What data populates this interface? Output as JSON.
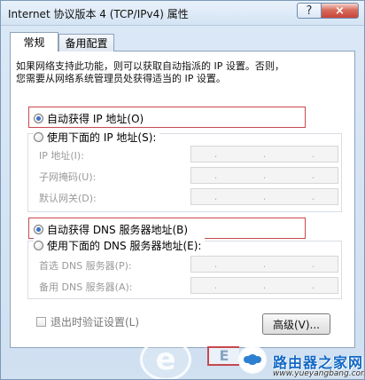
{
  "window": {
    "title": "Internet 协议版本 4 (TCP/IPv4) 属性",
    "help_button": "?",
    "close_button": "×"
  },
  "tabs": [
    {
      "label": "常规",
      "active": true
    },
    {
      "label": "备用配置",
      "active": false
    }
  ],
  "description": {
    "line1": "如果网络支持此功能，则可以获取自动指派的 IP 设置。否则，",
    "line2": "您需要从网络系统管理员处获得适当的 IP 设置。"
  },
  "ip_settings": {
    "auto_option": "自动获得 IP 地址(O)",
    "manual_option": "使用下面的 IP 地址(S):",
    "auto_selected": true,
    "fields": [
      {
        "label": "IP 地址(I):",
        "value": ""
      },
      {
        "label": "子网掩码(U):",
        "value": ""
      },
      {
        "label": "默认网关(D):",
        "value": ""
      }
    ]
  },
  "dns_settings": {
    "auto_option": "自动获得 DNS 服务器地址(B)",
    "manual_option": "使用下面的 DNS 服务器地址(E):",
    "auto_selected": true,
    "fields": [
      {
        "label": "首选 DNS 服务器(P):",
        "value": ""
      },
      {
        "label": "备用 DNS 服务器(A):",
        "value": ""
      }
    ]
  },
  "footer": {
    "validate_checkbox": "退出时验证设置(L)",
    "validate_checked": false,
    "advanced_button": "高级(V)..."
  },
  "watermark": {
    "logo_glyph": "e",
    "button_fragment": "E",
    "site_name": "路由器之家网",
    "site_url": "www.yueyangbang.com"
  },
  "colors": {
    "highlight": "#c7484e",
    "selected_radio": "#3b73c9",
    "watermark_blue": "#1268c6"
  },
  "icons": {
    "help": "help-icon",
    "close": "close-icon",
    "brand": "router-home-icon"
  }
}
